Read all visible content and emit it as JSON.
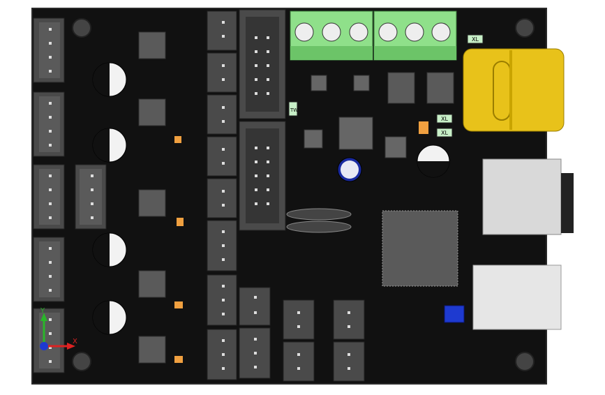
{
  "board": {
    "colors": {
      "pcb": "#111111",
      "pcb_edge": "#1c1c1c",
      "connector": "#4a4a4a",
      "terminal_green": "#8fe08a",
      "usb_yellow": "#e8c21a",
      "sd_metal": "#d9d9d9",
      "usb_b_metal": "#e6e6e6",
      "chip": "#5a5a5a",
      "capacitor": "#f2f2f2",
      "orange_smd": "#f0a040",
      "blue_switch": "#1e3ad0"
    },
    "markings": {
      "crystal_1": "XL",
      "crystal_2": "XL",
      "crystal_3": "XL",
      "diode_text": "TW"
    },
    "triad": {
      "y_label": "Y",
      "x_label": "X"
    }
  }
}
